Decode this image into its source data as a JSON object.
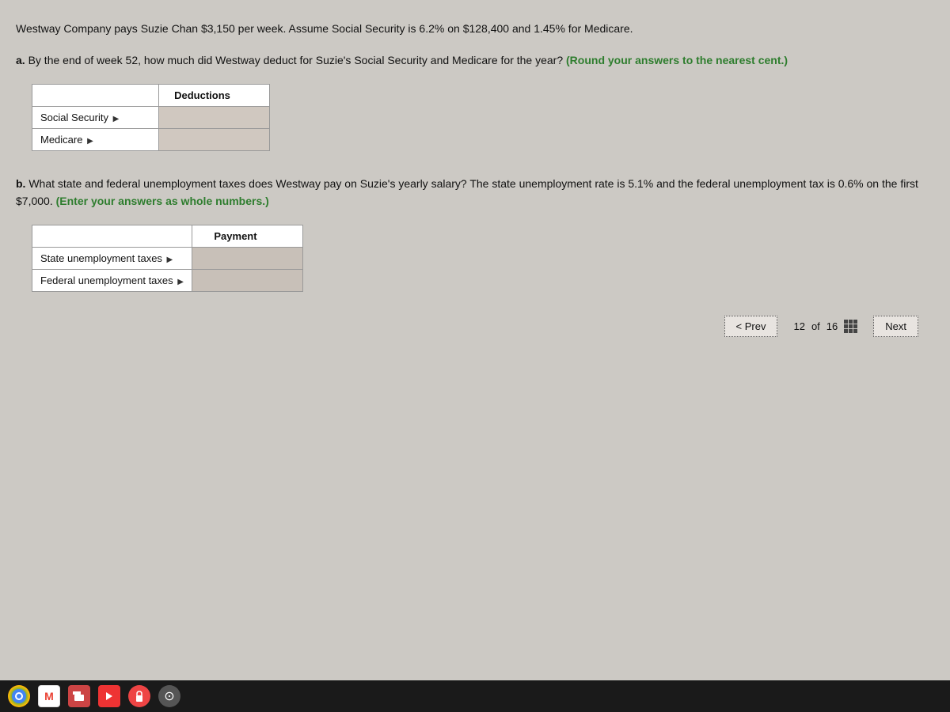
{
  "problem_a": {
    "text1": "Westway Company pays Suzie Chan $3,150 per week. Assume Social Security is 6.2% on $128,400 and 1.45% for Medicare.",
    "text2_part": "a.",
    "text2_main": " By the end of week 52, how much did Westway deduct for Suzie's Social Security and Medicare for the year?",
    "text2_highlight": " (Round your answers to the nearest cent.)",
    "table": {
      "header": "Deductions",
      "rows": [
        {
          "label": "Social Security",
          "value": ""
        },
        {
          "label": "Medicare",
          "value": ""
        }
      ]
    }
  },
  "problem_b": {
    "text1_part": "b.",
    "text1_main": " What state and federal unemployment taxes does Westway pay on Suzie's yearly salary? The state unemployment rate is 5.1% and the federal unemployment tax is 0.6% on the first $7,000.",
    "text1_highlight": " (Enter your answers as whole numbers.)",
    "table": {
      "header": "Payment",
      "rows": [
        {
          "label": "State unemployment taxes",
          "value": ""
        },
        {
          "label": "Federal unemployment taxes",
          "value": ""
        }
      ]
    }
  },
  "navigation": {
    "prev_label": "< Prev",
    "page_current": "12",
    "page_total": "16",
    "page_of": "of",
    "next_label": "Next"
  },
  "taskbar": {
    "icons": [
      "chrome",
      "gmail",
      "media",
      "lock",
      "dark"
    ]
  }
}
